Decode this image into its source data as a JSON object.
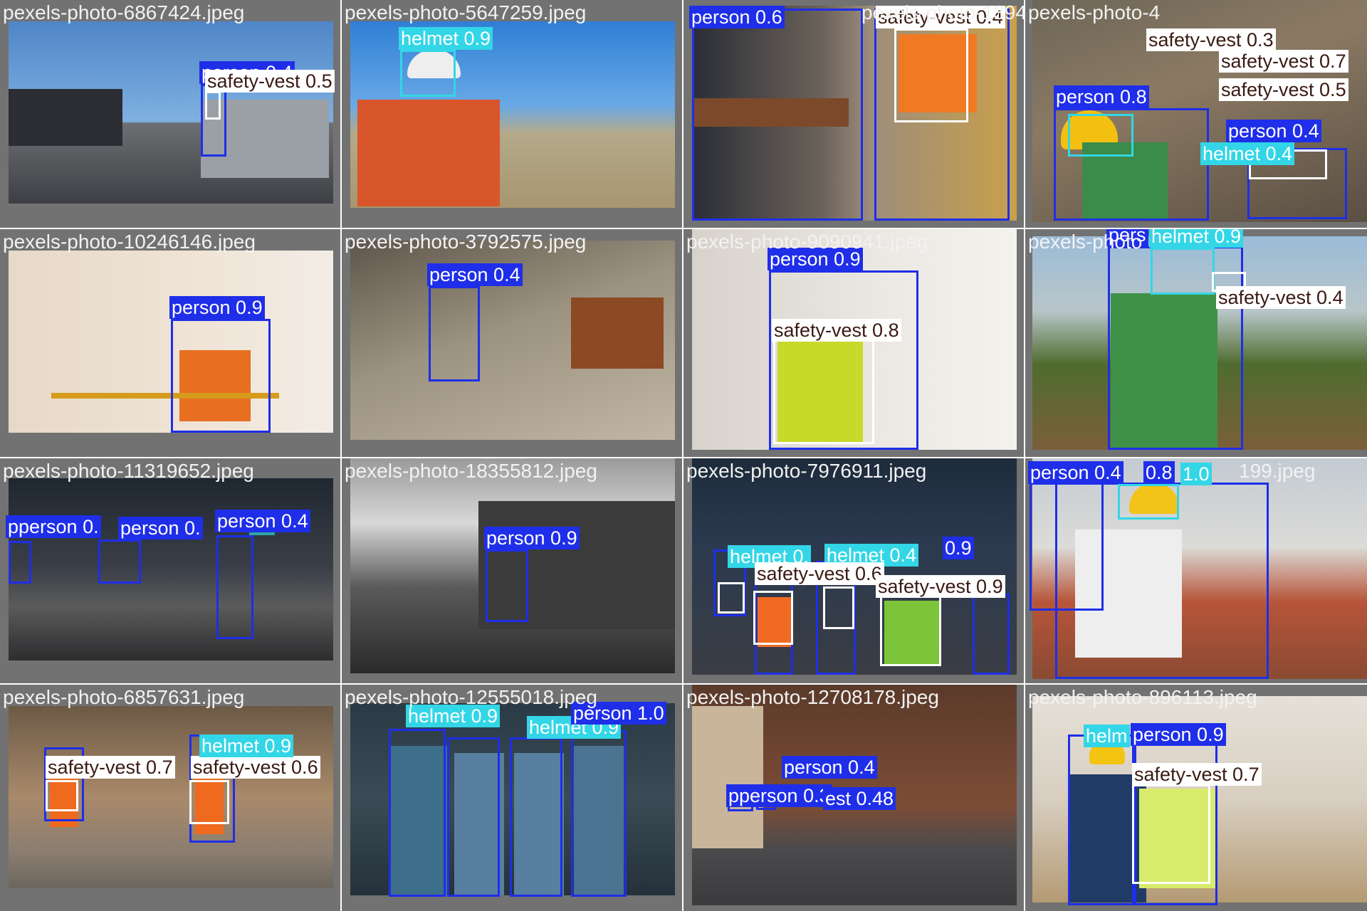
{
  "colors": {
    "person": "#1f2ee8",
    "helmet": "#33d6e6",
    "safety-vest": "#ffffff"
  },
  "tiles": [
    {
      "file": "pexels-photo-6867424.jpeg",
      "labels": [
        "person 0.4",
        "safety-vest 0.5"
      ]
    },
    {
      "file": "pexels-photo-5647259.jpeg",
      "labels": [
        "helmet 0.9"
      ]
    },
    {
      "file": "pexels-photo-1394",
      "labels": [
        "person 0.6",
        "safety-vest 0.4"
      ]
    },
    {
      "file": "pexels-photo-4",
      "labels": [
        "safety-vest 0.3",
        "safety-vest 0.7",
        "safety-vest 0.5",
        "person 0.8",
        "person 0.4",
        "helmet 0.4"
      ]
    },
    {
      "file": "pexels-photo-10246146.jpeg",
      "labels": [
        "person 0.9"
      ]
    },
    {
      "file": "pexels-photo-3792575.jpeg",
      "labels": [
        "person 0.4"
      ]
    },
    {
      "file": "pexels-photo-9090941.jpeg",
      "labels": [
        "person 0.9",
        "safety-vest 0.8"
      ]
    },
    {
      "file": "pexels-photo",
      "labels": [
        "pers",
        "helmet 0.9",
        "safety-vest 0.4"
      ]
    },
    {
      "file": "pexels-photo-11319652.jpeg",
      "labels": [
        "pperson 0.",
        "person 0.",
        "person 0.4"
      ]
    },
    {
      "file": "pexels-photo-18355812.jpeg",
      "labels": [
        "person 0.9"
      ]
    },
    {
      "file": "pexels-photo-7976911.jpeg",
      "labels": [
        "helmet 0.",
        "helmet 0.4",
        "safety-vest 0.6",
        "safety-vest 0.9",
        "0.9"
      ]
    },
    {
      "file": "199.jpeg",
      "labels": [
        "person 0.4",
        "0.8",
        "1.0"
      ]
    },
    {
      "file": "pexels-photo-6857631.jpeg",
      "labels": [
        "safety-vest 0.7",
        "safety-vest 0.6",
        "helmet 0.9"
      ]
    },
    {
      "file": "pexels-photo-12555018.jpeg",
      "labels": [
        "helmet 0.9",
        "helmet 0.9",
        "person 1.0"
      ]
    },
    {
      "file": "pexels-photo-12708178.jpeg",
      "labels": [
        "person 0.4",
        "pperson 0.3",
        "est 0.48"
      ]
    },
    {
      "file": "pexels-photo-896113.jpeg",
      "labels": [
        "person 0.9",
        "safety-vest 0.7",
        "helm"
      ]
    }
  ]
}
